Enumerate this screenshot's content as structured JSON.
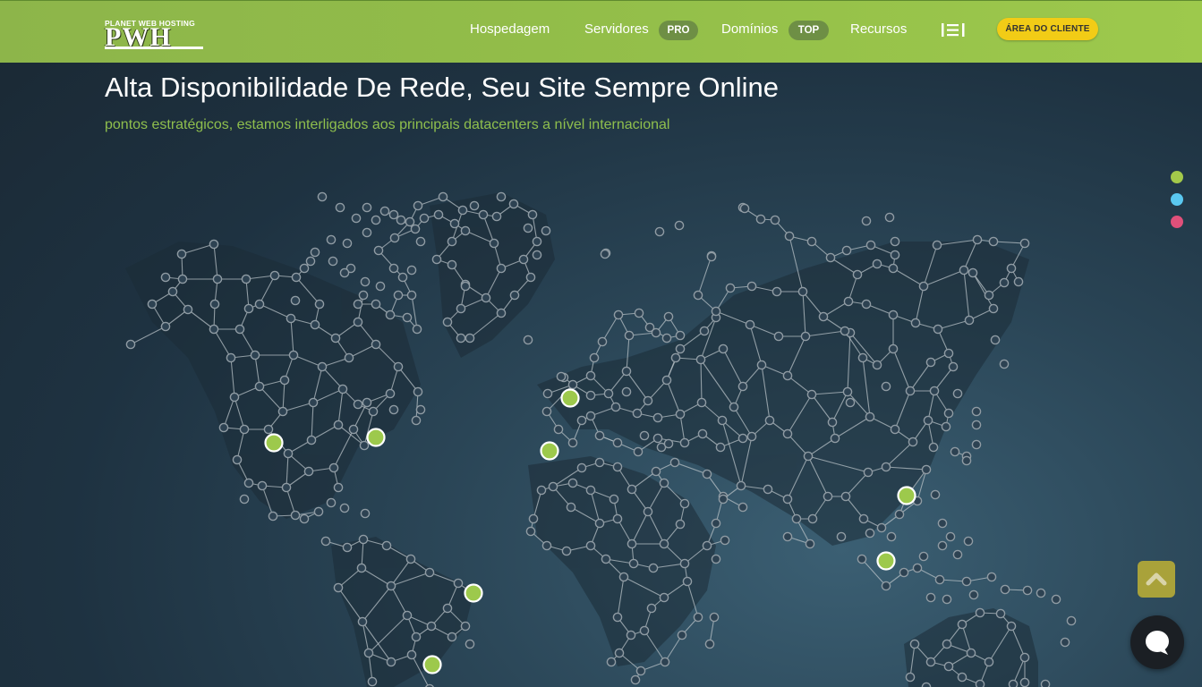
{
  "header": {
    "logo": {
      "top_text": "PLANET WEB HOSTING",
      "main_text": "PWH"
    },
    "nav": [
      {
        "label": "Hospedagem"
      },
      {
        "label": "Servidores",
        "badge": "PRO"
      },
      {
        "label": "Domínios",
        "badge": "TOP"
      },
      {
        "label": "Recursos"
      }
    ],
    "menu_icon": "menu-icon",
    "client_button": "ÁREA DO CLIENTE"
  },
  "hero": {
    "title": "Alta Disponibilidade De Rede, Seu Site Sempre Online",
    "subtitle": "pontos estratégicos, estamos interligados aos principais datacenters a nível internacional"
  },
  "map": {
    "datacenter_color": "#9dc94c",
    "node_color": "#8f9ba3",
    "line_color": "#b7c0c6"
  },
  "slider_dots": [
    {
      "color": "#a3c94a",
      "active": true
    },
    {
      "color": "#5ac8f0",
      "active": false
    },
    {
      "color": "#e0507a",
      "active": false
    }
  ],
  "floating": {
    "scroll_top_icon": "chevron-up-icon",
    "chat_icon": "chat-bubble-icon"
  },
  "colors": {
    "header_green": "#92bd49",
    "accent_yellow": "#f2cc16",
    "subtitle_green": "#8fbf4d",
    "background_dark": "#1e3241"
  }
}
